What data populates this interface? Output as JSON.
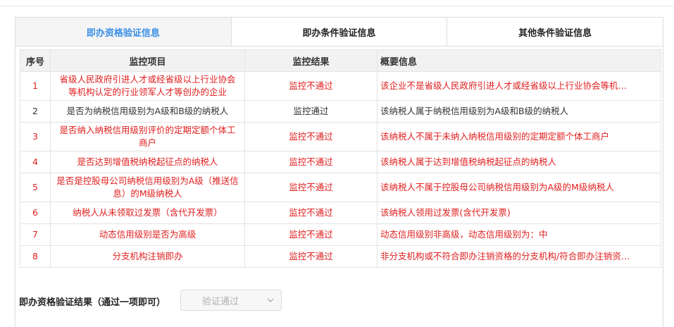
{
  "tabs": [
    {
      "label": "即办资格验证信息",
      "active": true
    },
    {
      "label": "即办条件验证信息",
      "active": false
    },
    {
      "label": "其他条件验证信息",
      "active": false
    }
  ],
  "table": {
    "headers": [
      "序号",
      "监控项目",
      "监控结果",
      "概要信息"
    ],
    "rows": [
      {
        "no": "1",
        "item": "省级人民政府引进人才或经省级以上行业协会等机构认定的行业领军人才等创办的企业",
        "result": "监控不通过",
        "summary": "该企业不是省级人民政府引进人才或经省级以上行业协会等机…",
        "status": "fail"
      },
      {
        "no": "2",
        "item": "是否为纳税信用级别为A级和B级的纳税人",
        "result": "监控通过",
        "summary": "该纳税人属于纳税信用级别为A级和B级的纳税人",
        "status": "pass"
      },
      {
        "no": "3",
        "item": "是否纳入纳税信用级别评价的定期定额个体工商户",
        "result": "监控不通过",
        "summary": "该纳税人不属于未纳入纳税信用级别的定期定额个体工商户",
        "status": "fail"
      },
      {
        "no": "4",
        "item": "是否达到增值税纳税起征点的纳税人",
        "result": "监控不通过",
        "summary": "该纳税人属于达到增值税纳税起征点的纳税人",
        "status": "fail"
      },
      {
        "no": "5",
        "item": "是否是控股母公司纳税信用级别为A级（推送信息）的M级纳税人",
        "result": "监控不通过",
        "summary": "该纳税人不属于控股母公司纳税信用级别为A级的M级纳税人",
        "status": "fail"
      },
      {
        "no": "6",
        "item": "纳税人从未领取过发票（含代开发票）",
        "result": "监控不通过",
        "summary": "该纳税人领用过发票(含代开发票)",
        "status": "fail"
      },
      {
        "no": "7",
        "item": "动态信用级别是否为高级",
        "result": "监控不通过",
        "summary": "动态信用级别非高级，动态信用级别为：中",
        "status": "fail"
      },
      {
        "no": "8",
        "item": "分支机构注销即办",
        "result": "监控不通过",
        "summary": "非分支机构或不符合即办注销资格的分支机构/符合即办注销资…",
        "status": "fail"
      }
    ]
  },
  "result": {
    "label": "即办资格验证结果（通过一项即可）",
    "select_value": "验证通过"
  },
  "icons": {
    "select_chevron": "chevron-down-icon"
  },
  "colors": {
    "accent": "#3a8ee6",
    "fail": "#e02020",
    "pass": "#333333"
  }
}
